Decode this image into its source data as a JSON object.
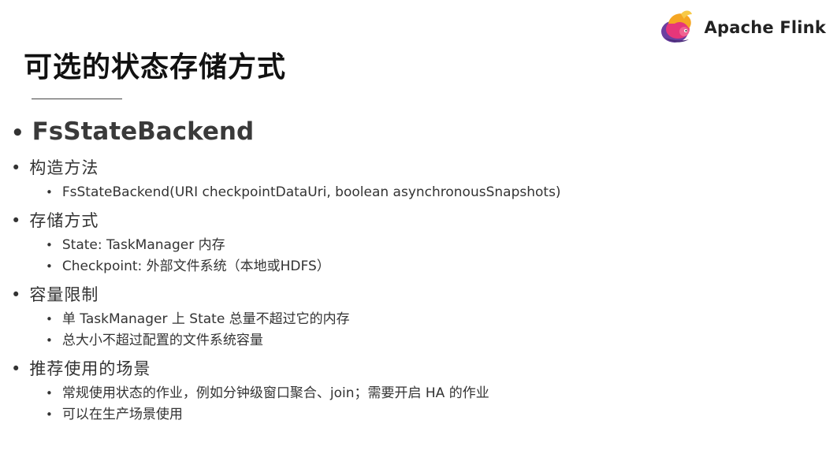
{
  "logo": {
    "text": "Apache Flink",
    "icon": "flink-squirrel-logo"
  },
  "slide": {
    "title": "可选的状态存储方式",
    "main_bullet": "FsStateBackend",
    "sections": [
      {
        "heading": "构造方法",
        "items": [
          "FsStateBackend(URI checkpointDataUri, boolean asynchronousSnapshots)"
        ]
      },
      {
        "heading": "存储方式",
        "items": [
          "State: TaskManager 内存",
          "Checkpoint: 外部文件系统（本地或HDFS）"
        ]
      },
      {
        "heading": "容量限制",
        "items": [
          "单 TaskManager 上 State 总量不超过它的内存",
          "总大小不超过配置的文件系统容量"
        ]
      },
      {
        "heading": "推荐使用的场景",
        "items": [
          "常规使用状态的作业，例如分钟级窗口聚合、join；需要开启 HA 的作业",
          "可以在生产场景使用"
        ]
      }
    ]
  },
  "colors": {
    "title": "#111111",
    "text": "#333333",
    "logo_pink": "#e6367a",
    "logo_purple": "#6b3fa0",
    "logo_orange": "#f5a623"
  }
}
